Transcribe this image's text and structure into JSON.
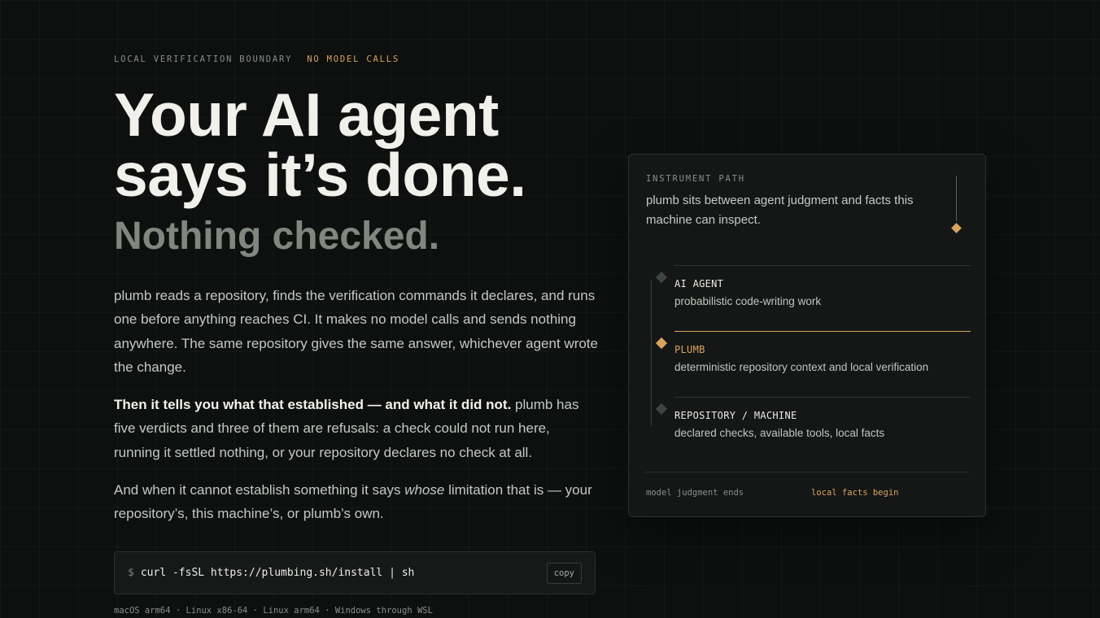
{
  "hero": {
    "eyebrow": "LOCAL VERIFICATION BOUNDARY",
    "eyebrow_accent": "NO MODEL CALLS",
    "headline_line1": "Your AI agent",
    "headline_line2": "says it’s done.",
    "subhead": "Nothing checked.",
    "para1": "plumb reads a repository, finds the verification commands it declares, and runs one before anything reaches CI. It makes no model calls and sends nothing anywhere. The same repository gives the same answer, whichever agent wrote the change.",
    "para2_strong": "Then it tells you what that established — and what it did not.",
    "para2_rest": " plumb has five verdicts and three of them are refusals: a check could not run here, running it settled nothing, or your repository declares no check at all.",
    "para3_a": "And when it cannot establish something it says ",
    "para3_em": "whose",
    "para3_b": " limitation that is — your repository’s, this machine’s, or plumb’s own."
  },
  "install": {
    "prompt": "$",
    "command": "curl -fsSL https://plumbing.sh/install | sh",
    "copy_label": "copy",
    "platforms": "macOS arm64 · Linux x86-64 · Linux arm64 · Windows through WSL"
  },
  "card": {
    "title": "INSTRUMENT PATH",
    "description": "plumb sits between agent judgment and facts this machine can inspect.",
    "layers": [
      {
        "name": "AI AGENT",
        "desc": "probabilistic code-writing work",
        "active": false
      },
      {
        "name": "PLUMB",
        "desc": "deterministic repository context and local verification",
        "active": true
      },
      {
        "name": "REPOSITORY / MACHINE",
        "desc": "declared checks, available tools, local facts",
        "active": false
      }
    ],
    "footer_left": "model judgment ends",
    "footer_right": "local facts begin"
  },
  "colors": {
    "accent": "#d9a45c",
    "background": "#0e1010",
    "card": "#141716"
  }
}
